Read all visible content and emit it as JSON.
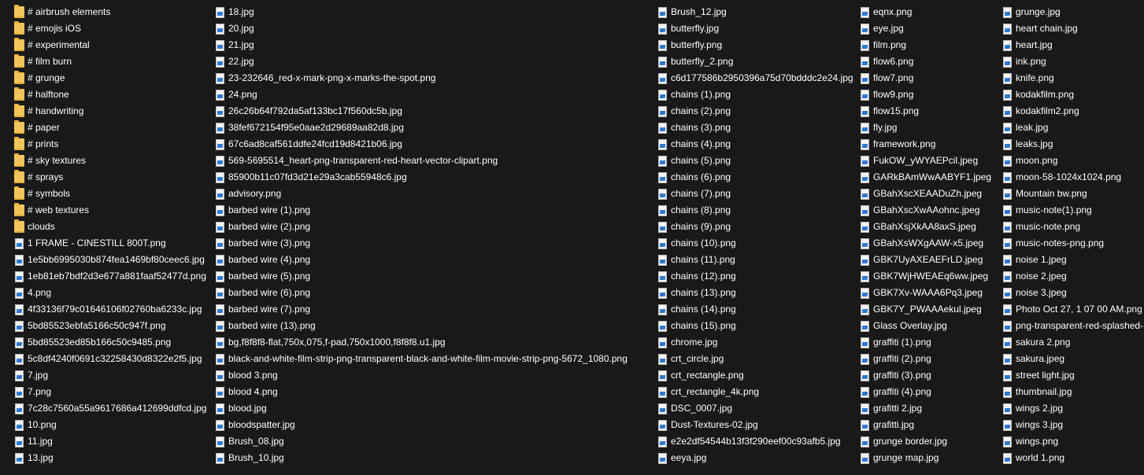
{
  "columns": [
    {
      "items": [
        {
          "type": "folder",
          "name": "# airbrush elements"
        },
        {
          "type": "folder",
          "name": "# emojis iOS"
        },
        {
          "type": "folder",
          "name": "# experimental"
        },
        {
          "type": "folder",
          "name": "# film burn"
        },
        {
          "type": "folder",
          "name": "# grunge"
        },
        {
          "type": "folder",
          "name": "# halftone"
        },
        {
          "type": "folder",
          "name": "# handwriting"
        },
        {
          "type": "folder",
          "name": "# paper"
        },
        {
          "type": "folder",
          "name": "# prints"
        },
        {
          "type": "folder",
          "name": "# sky textures"
        },
        {
          "type": "folder",
          "name": "# sprays"
        },
        {
          "type": "folder",
          "name": "# symbols"
        },
        {
          "type": "folder",
          "name": "# web textures"
        },
        {
          "type": "folder",
          "name": "clouds"
        },
        {
          "type": "file",
          "name": "1 FRAME - CINESTILL 800T.png"
        },
        {
          "type": "file",
          "name": "1e5bb6995030b874fea1469bf80ceec6.jpg"
        },
        {
          "type": "file",
          "name": "1eb81eb7bdf2d3e677a881faaf52477d.png"
        },
        {
          "type": "file",
          "name": "4.png"
        },
        {
          "type": "file",
          "name": "4f33136f79c01646106f02760ba6233c.jpg"
        },
        {
          "type": "file",
          "name": "5bd85523ebfa5166c50c947f.png"
        },
        {
          "type": "file",
          "name": "5bd85523ed85b166c50c9485.png"
        },
        {
          "type": "file",
          "name": "5c8df4240f0691c32258430d8322e2f5.jpg"
        },
        {
          "type": "file",
          "name": "7.jpg"
        },
        {
          "type": "file",
          "name": "7.png"
        },
        {
          "type": "file",
          "name": "7c28c7560a55a9617686a412699ddfcd.jpg"
        },
        {
          "type": "file",
          "name": "10.png"
        },
        {
          "type": "file",
          "name": "11.jpg"
        },
        {
          "type": "file",
          "name": "13.jpg"
        }
      ]
    },
    {
      "items": [
        {
          "type": "file",
          "name": "18.jpg"
        },
        {
          "type": "file",
          "name": "20.jpg"
        },
        {
          "type": "file",
          "name": "21.jpg"
        },
        {
          "type": "file",
          "name": "22.jpg"
        },
        {
          "type": "file",
          "name": "23-232646_red-x-mark-png-x-marks-the-spot.png"
        },
        {
          "type": "file",
          "name": "24.png"
        },
        {
          "type": "file",
          "name": "26c26b64f792da5af133bc17f560dc5b.jpg"
        },
        {
          "type": "file",
          "name": "38fef672154f95e0aae2d29689aa82d8.jpg"
        },
        {
          "type": "file",
          "name": "67c6ad8caf561ddfe24fcd19d8421b06.jpg"
        },
        {
          "type": "file",
          "name": "569-5695514_heart-png-transparent-red-heart-vector-clipart.png"
        },
        {
          "type": "file",
          "name": "85900b11c07fd3d21e29a3cab55948c6.jpg"
        },
        {
          "type": "file",
          "name": "advisory.png"
        },
        {
          "type": "file",
          "name": "barbed wire (1).png"
        },
        {
          "type": "file",
          "name": "barbed wire (2).png"
        },
        {
          "type": "file",
          "name": "barbed wire (3).png"
        },
        {
          "type": "file",
          "name": "barbed wire (4).png"
        },
        {
          "type": "file",
          "name": "barbed wire (5).png"
        },
        {
          "type": "file",
          "name": "barbed wire (6).png"
        },
        {
          "type": "file",
          "name": "barbed wire (7).png"
        },
        {
          "type": "file",
          "name": "barbed wire (13).png"
        },
        {
          "type": "file",
          "name": "bg,f8f8f8-flat,750x,075,f-pad,750x1000,f8f8f8.u1.jpg"
        },
        {
          "type": "file",
          "name": "black-and-white-film-strip-png-transparent-black-and-white-film-movie-strip-png-5672_1080.png"
        },
        {
          "type": "file",
          "name": "blood 3.png"
        },
        {
          "type": "file",
          "name": "blood 4.png"
        },
        {
          "type": "file",
          "name": "blood.jpg"
        },
        {
          "type": "file",
          "name": "bloodspatter.jpg"
        },
        {
          "type": "file",
          "name": "Brush_08.jpg"
        },
        {
          "type": "file",
          "name": "Brush_10.jpg"
        }
      ]
    },
    {
      "items": [
        {
          "type": "file",
          "name": "Brush_12.jpg"
        },
        {
          "type": "file",
          "name": "butterfly.jpg"
        },
        {
          "type": "file",
          "name": "butterfly.png"
        },
        {
          "type": "file",
          "name": "butterfly_2.png"
        },
        {
          "type": "file",
          "name": "c6d177586b2950396a75d70bdddc2e24.jpg"
        },
        {
          "type": "file",
          "name": "chains (1).png"
        },
        {
          "type": "file",
          "name": "chains (2).png"
        },
        {
          "type": "file",
          "name": "chains (3).png"
        },
        {
          "type": "file",
          "name": "chains (4).png"
        },
        {
          "type": "file",
          "name": "chains (5).png"
        },
        {
          "type": "file",
          "name": "chains (6).png"
        },
        {
          "type": "file",
          "name": "chains (7).png"
        },
        {
          "type": "file",
          "name": "chains (8).png"
        },
        {
          "type": "file",
          "name": "chains (9).png"
        },
        {
          "type": "file",
          "name": "chains (10).png"
        },
        {
          "type": "file",
          "name": "chains (11).png"
        },
        {
          "type": "file",
          "name": "chains (12).png"
        },
        {
          "type": "file",
          "name": "chains (13).png"
        },
        {
          "type": "file",
          "name": "chains (14).png"
        },
        {
          "type": "file",
          "name": "chains (15).png"
        },
        {
          "type": "file",
          "name": "chrome.jpg"
        },
        {
          "type": "file",
          "name": "crt_circle.jpg"
        },
        {
          "type": "file",
          "name": "crt_rectangle.png"
        },
        {
          "type": "file",
          "name": "crt_rectangle_4k.png"
        },
        {
          "type": "file",
          "name": "DSC_0007.jpg"
        },
        {
          "type": "file",
          "name": "Dust-Textures-02.jpg"
        },
        {
          "type": "file",
          "name": "e2e2df54544b13f3f290eef00c93afb5.jpg"
        },
        {
          "type": "file",
          "name": "eeya.jpg"
        }
      ]
    },
    {
      "items": [
        {
          "type": "file",
          "name": "eqnx.png"
        },
        {
          "type": "file",
          "name": "eye.jpg"
        },
        {
          "type": "file",
          "name": "film.png"
        },
        {
          "type": "file",
          "name": "flow6.png"
        },
        {
          "type": "file",
          "name": "flow7.png"
        },
        {
          "type": "file",
          "name": "flow9.png"
        },
        {
          "type": "file",
          "name": "flow15.png"
        },
        {
          "type": "file",
          "name": "fly.jpg"
        },
        {
          "type": "file",
          "name": "framework.png"
        },
        {
          "type": "file",
          "name": "FukOW_yWYAEPcil.jpeg"
        },
        {
          "type": "file",
          "name": "GARkBAmWwAABYF1.jpeg"
        },
        {
          "type": "file",
          "name": "GBahXscXEAADuZh.jpeg"
        },
        {
          "type": "file",
          "name": "GBahXscXwAAohnc.jpeg"
        },
        {
          "type": "file",
          "name": "GBahXsjXkAA8axS.jpeg"
        },
        {
          "type": "file",
          "name": "GBahXsWXgAAW-x5.jpeg"
        },
        {
          "type": "file",
          "name": "GBK7UyAXEAEFrLD.jpeg"
        },
        {
          "type": "file",
          "name": "GBK7WjHWEAEq6ww.jpeg"
        },
        {
          "type": "file",
          "name": "GBK7Xv-WAAA6Pq3.jpeg"
        },
        {
          "type": "file",
          "name": "GBK7Y_PWAAAekul.jpeg"
        },
        {
          "type": "file",
          "name": "Glass Overlay.jpg"
        },
        {
          "type": "file",
          "name": "graffiti (1).png"
        },
        {
          "type": "file",
          "name": "graffiti (2).png"
        },
        {
          "type": "file",
          "name": "graffiti (3).png"
        },
        {
          "type": "file",
          "name": "graffiti (4).png"
        },
        {
          "type": "file",
          "name": "grafitti 2.jpg"
        },
        {
          "type": "file",
          "name": "grafitti.jpg"
        },
        {
          "type": "file",
          "name": "grunge border.jpg"
        },
        {
          "type": "file",
          "name": "grunge map.jpg"
        }
      ]
    },
    {
      "items": [
        {
          "type": "file",
          "name": "grunge.jpg"
        },
        {
          "type": "file",
          "name": "heart chain.jpg"
        },
        {
          "type": "file",
          "name": "heart.jpg"
        },
        {
          "type": "file",
          "name": "ink.png"
        },
        {
          "type": "file",
          "name": "knife.png"
        },
        {
          "type": "file",
          "name": "kodakfilm.png"
        },
        {
          "type": "file",
          "name": "kodakfilm2.png"
        },
        {
          "type": "file",
          "name": "leak.jpg"
        },
        {
          "type": "file",
          "name": "leaks.jpg"
        },
        {
          "type": "file",
          "name": "moon.png"
        },
        {
          "type": "file",
          "name": "moon-58-1024x1024.png"
        },
        {
          "type": "file",
          "name": "Mountain bw.png"
        },
        {
          "type": "file",
          "name": "music-note(1).png"
        },
        {
          "type": "file",
          "name": "music-note.png"
        },
        {
          "type": "file",
          "name": "music-notes-png.png"
        },
        {
          "type": "file",
          "name": "noise 1.jpeg"
        },
        {
          "type": "file",
          "name": "noise 2.jpeg"
        },
        {
          "type": "file",
          "name": "noise 3.jpeg"
        },
        {
          "type": "file",
          "name": "Photo Oct 27, 1 07 00 AM.png"
        },
        {
          "type": "file",
          "name": "png-transparent-red-splashed-"
        },
        {
          "type": "file",
          "name": "sakura 2.png"
        },
        {
          "type": "file",
          "name": "sakura.jpeg"
        },
        {
          "type": "file",
          "name": "street light.jpg"
        },
        {
          "type": "file",
          "name": "thumbnail.jpg"
        },
        {
          "type": "file",
          "name": "wings 2.jpg"
        },
        {
          "type": "file",
          "name": "wings 3.jpg"
        },
        {
          "type": "file",
          "name": "wings.png"
        },
        {
          "type": "file",
          "name": "world 1.png"
        }
      ]
    }
  ],
  "colors": {
    "background": "#191919",
    "text": "#ffffff",
    "folder": "#f2c55c",
    "file_thumbnail": "#2a6fc7"
  },
  "icons": {
    "folder": "folder-icon",
    "file": "image-file-icon"
  }
}
